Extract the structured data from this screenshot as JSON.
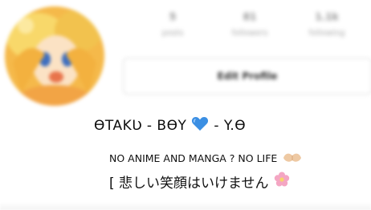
{
  "profile": {
    "avatar_icon": "anime-character-avatar",
    "stats": [
      {
        "value": "5",
        "label": "posts"
      },
      {
        "value": "81",
        "label": "followers"
      },
      {
        "value": "1.1k",
        "label": "following"
      }
    ],
    "edit_button_label": "Edit Profile",
    "display_name_left": "ϴTAKƲ - BϴY",
    "display_name_right": "- Y.ϴ",
    "name_emoji": "blue-heart-icon",
    "bio_line1": "NO ANIME AND MANGA ? NO LIFE",
    "bio_line1_emoji": "folded-hands-icon",
    "bio_line2": "[ 悲しい笑顔はいけません",
    "bio_line2_emoji": "cherry-blossom-icon"
  },
  "colors": {
    "heart": "#3b8fe3",
    "blossom": "#f4a6c3",
    "hands": "#eec9a3",
    "avatar_primary": "#f4b43a",
    "avatar_hair": "#f7d35c"
  }
}
